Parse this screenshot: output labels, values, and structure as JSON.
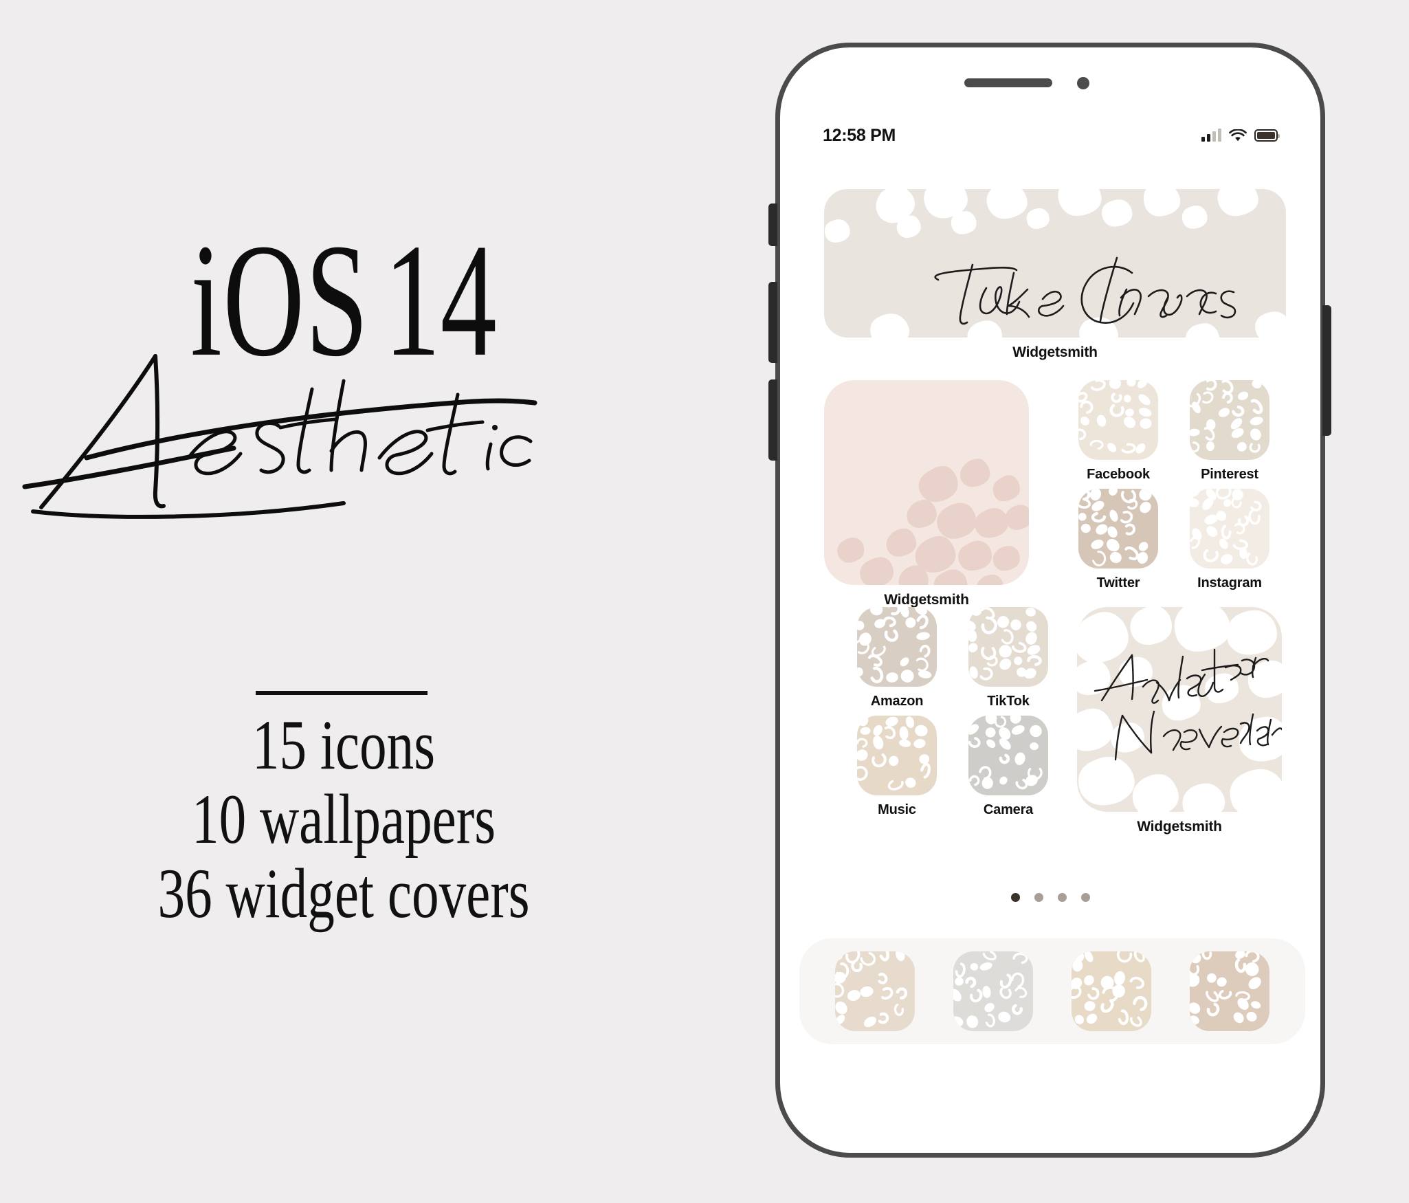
{
  "promo": {
    "title_main": "iOS",
    "title_version": "14",
    "script_word": "Aesthetic",
    "features": [
      "15 icons",
      "10 wallpapers",
      "36 widget covers"
    ]
  },
  "phone": {
    "status_bar": {
      "time": "12:58 PM",
      "cellular_icon": "cellular-bars-icon",
      "wifi_icon": "wifi-icon",
      "battery_icon": "battery-icon"
    },
    "hardware": {
      "speaker_icon": "speaker-grille-icon",
      "camera_icon": "front-camera-icon",
      "mute_switch": "mute-switch",
      "volume_up": "volume-up-button",
      "volume_down": "volume-down-button",
      "power": "power-button"
    },
    "widgets": {
      "top": {
        "label": "Widgetsmith",
        "quote": "Take Chances",
        "bg": "#eae4de",
        "spot_color": "#ffffff"
      },
      "mid_left": {
        "label": "Widgetsmith",
        "bg": "#f4e6e0",
        "spot_color": "#e8d2c9"
      },
      "bottom_right": {
        "label": "Widgetsmith",
        "quote_line1": "Always forward",
        "quote_line2": "Never back",
        "bg": "#ece5de",
        "spot_color": "#ffffff"
      }
    },
    "apps": [
      {
        "label": "Facebook",
        "bg": "#eee5da",
        "spot_color": "#ffffff"
      },
      {
        "label": "Pinterest",
        "bg": "#e3dace",
        "spot_color": "#ffffff"
      },
      {
        "label": "Twitter",
        "bg": "#d6c6b8",
        "spot_color": "#ffffff"
      },
      {
        "label": "Instagram",
        "bg": "#f2ece4",
        "spot_color": "#ffffff"
      },
      {
        "label": "Amazon",
        "bg": "#d8cec3",
        "spot_color": "#ffffff"
      },
      {
        "label": "TikTok",
        "bg": "#e4dcd1",
        "spot_color": "#ffffff"
      },
      {
        "label": "Music",
        "bg": "#e6d9c8",
        "spot_color": "#ffffff"
      },
      {
        "label": "Camera",
        "bg": "#cfcdc9",
        "spot_color": "#ffffff"
      }
    ],
    "dock": [
      {
        "name": "dock-app-1",
        "bg": "#e6dbcd",
        "spot_color": "#ffffff"
      },
      {
        "name": "dock-app-2",
        "bg": "#dedcd9",
        "spot_color": "#ffffff"
      },
      {
        "name": "dock-app-3",
        "bg": "#e7dac7",
        "spot_color": "#ffffff"
      },
      {
        "name": "dock-app-4",
        "bg": "#ddcbbc",
        "spot_color": "#ffffff"
      }
    ],
    "page_dots": {
      "count": 4,
      "active_index": 0
    }
  },
  "colors": {
    "background": "#efeded",
    "ink": "#111111",
    "phone_frame": "#4b4b4b",
    "dock_bg": "#f7f6f5",
    "dot_active": "#3a332c",
    "dot_inactive": "#a79e95"
  }
}
